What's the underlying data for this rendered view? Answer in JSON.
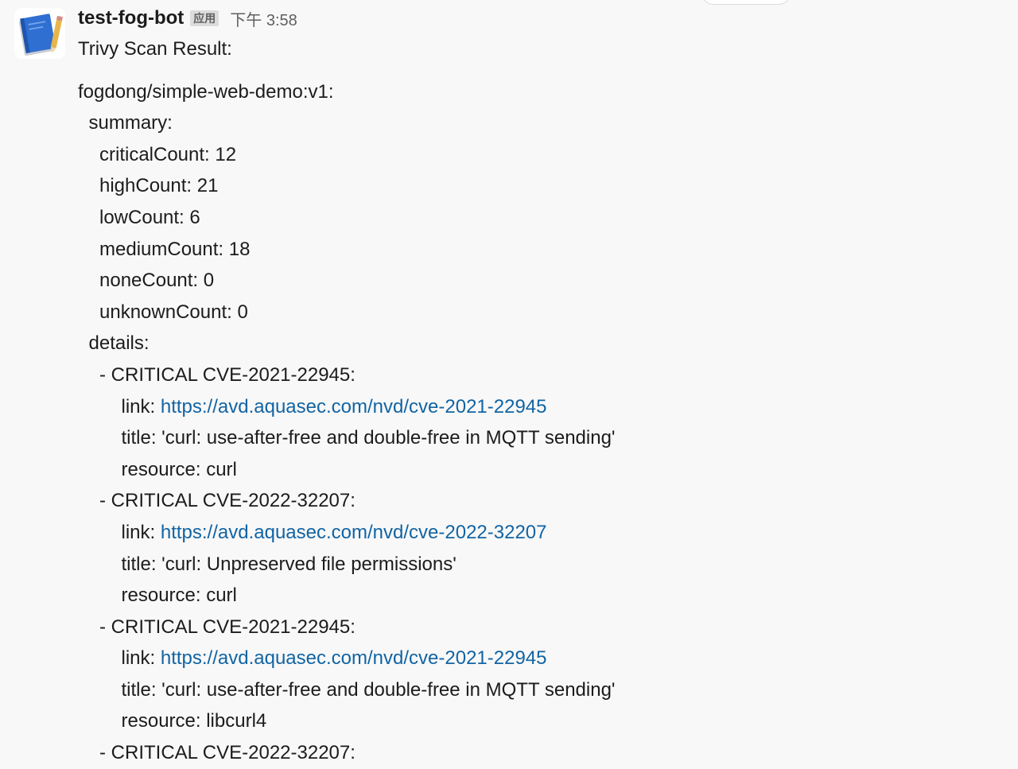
{
  "message": {
    "sender": "test-fog-bot",
    "badge": "应用",
    "timestamp": "下午 3:58",
    "title": "Trivy Scan Result:",
    "image": "fogdong/simple-web-demo:v1:",
    "summary": {
      "label": "summary:",
      "counts": [
        "criticalCount: 12",
        "highCount: 21",
        "lowCount: 6",
        "mediumCount: 18",
        "noneCount: 0",
        "unknownCount: 0"
      ]
    },
    "details": {
      "label": "details:",
      "link_label": "link: ",
      "items": [
        {
          "heading": "- CRITICAL CVE-2021-22945:",
          "link": "https://avd.aquasec.com/nvd/cve-2021-22945",
          "title": "title: 'curl: use-after-free and double-free in MQTT sending'",
          "resource": "resource: curl"
        },
        {
          "heading": "- CRITICAL CVE-2022-32207:",
          "link": "https://avd.aquasec.com/nvd/cve-2022-32207",
          "title": "title: 'curl: Unpreserved file permissions'",
          "resource": "resource: curl"
        },
        {
          "heading": "- CRITICAL CVE-2021-22945:",
          "link": "https://avd.aquasec.com/nvd/cve-2021-22945",
          "title": "title: 'curl: use-after-free and double-free in MQTT sending'",
          "resource": "resource: libcurl4"
        },
        {
          "heading": "- CRITICAL CVE-2022-32207:"
        }
      ]
    }
  },
  "icons": {
    "avatar": "notebook-pencil-icon"
  },
  "colors": {
    "background": "#f8f8f8",
    "link": "#1264a3",
    "text": "#1d1c1d",
    "muted": "#616061",
    "badge_bg": "#dcdcdc",
    "avatar_book": "#2f6fd1"
  }
}
